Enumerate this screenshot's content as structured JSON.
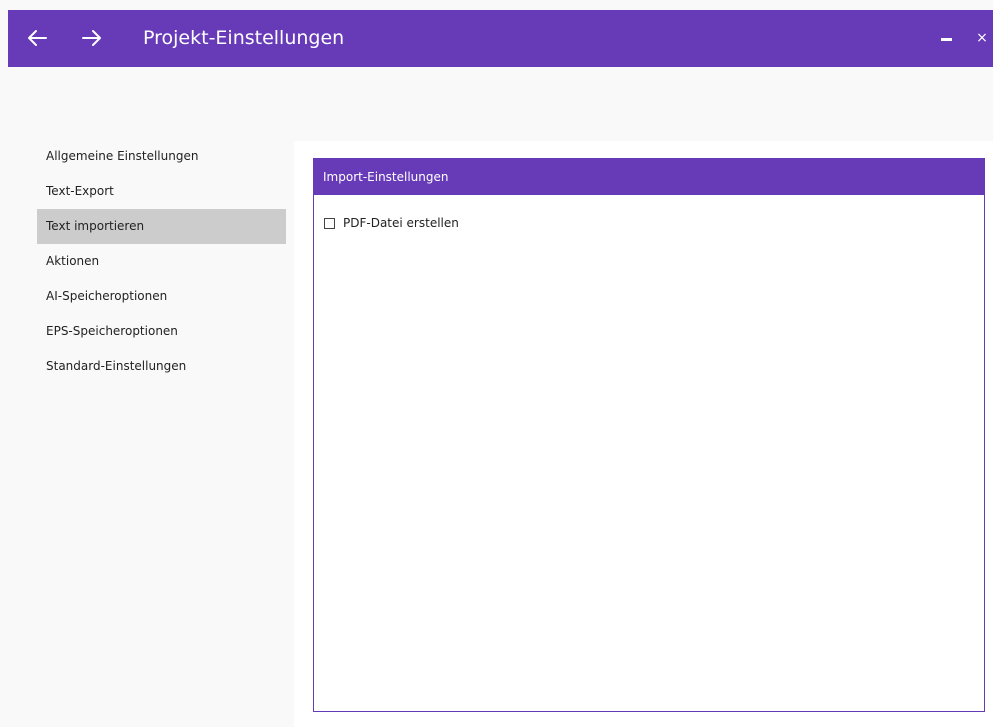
{
  "window": {
    "title": "Projekt-Einstellungen",
    "close_glyph": "×",
    "accent_color": "#673ab7"
  },
  "icons": {
    "back": "arrow-left-icon",
    "forward": "arrow-right-icon",
    "minimize": "minimize-icon",
    "close": "close-icon"
  },
  "sidebar": {
    "items": [
      {
        "label": "Allgemeine Einstellungen",
        "active": false
      },
      {
        "label": "Text-Export",
        "active": false
      },
      {
        "label": "Text importieren",
        "active": true
      },
      {
        "label": "Aktionen",
        "active": false
      },
      {
        "label": "AI-Speicheroptionen",
        "active": false
      },
      {
        "label": "EPS-Speicheroptionen",
        "active": false
      },
      {
        "label": "Standard-Einstellungen",
        "active": false
      }
    ]
  },
  "panel": {
    "header": "Import-Einstellungen",
    "options": [
      {
        "label": "PDF-Datei erstellen",
        "checked": false
      }
    ]
  }
}
